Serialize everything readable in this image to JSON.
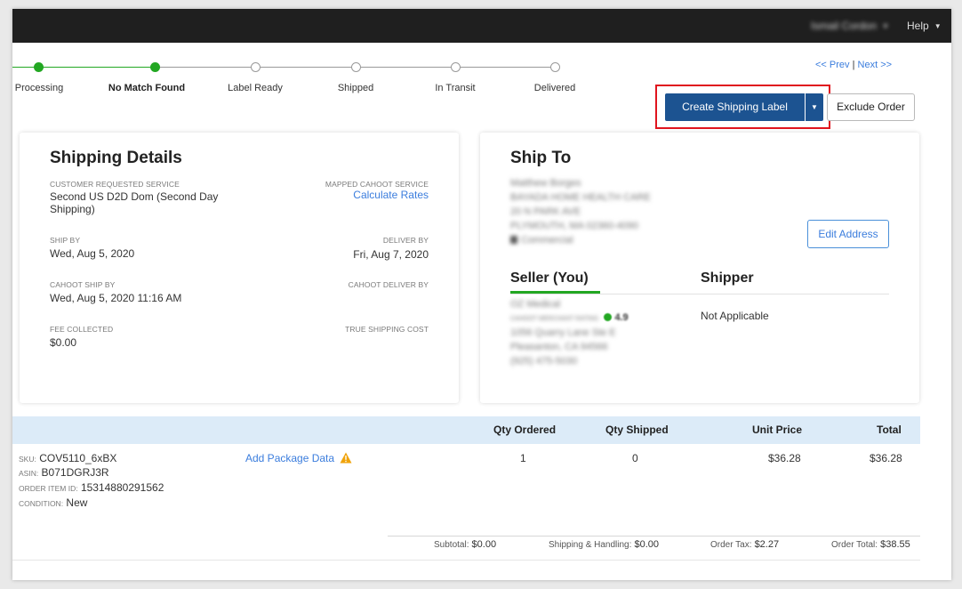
{
  "topbar": {
    "user_menu": "Ismail Cordon",
    "help": "Help",
    "caret": "▼"
  },
  "progress": {
    "steps": [
      {
        "label": "Processing",
        "status": "done"
      },
      {
        "label": "No Match Found",
        "status": "current"
      },
      {
        "label": "Label Ready",
        "status": "pending"
      },
      {
        "label": "Shipped",
        "status": "pending"
      },
      {
        "label": "In Transit",
        "status": "pending"
      },
      {
        "label": "Delivered",
        "status": "pending"
      }
    ],
    "done_color": "#22a722"
  },
  "pager": {
    "prev": "<< Prev",
    "separator": "|",
    "next": "Next >>"
  },
  "actions": {
    "create_label": "Create Shipping Label",
    "exclude_order": "Exclude Order",
    "primary_color": "#1c5391",
    "highlight_color": "#e0141e"
  },
  "shipping_details": {
    "title": "Shipping Details",
    "customer_service_label": "CUSTOMER REQUESTED SERVICE",
    "customer_service_line1": "Second US D2D Dom (Second Day",
    "customer_service_line2": "Shipping)",
    "mapped_label": "MAPPED CAHOOT SERVICE",
    "calculate_rates": "Calculate Rates",
    "ship_by_label": "SHIP BY",
    "ship_by": "Wed, Aug 5, 2020",
    "deliver_by_label": "DELIVER BY",
    "deliver_by": "Fri, Aug 7, 2020",
    "cahoot_ship_by_label": "CAHOOT SHIP BY",
    "cahoot_ship_by": "Wed, Aug 5, 2020 11:16 AM",
    "cahoot_deliver_by_label": "CAHOOT DELIVER BY",
    "fee_label": "FEE COLLECTED",
    "fee": "$0.00",
    "true_cost_label": "TRUE SHIPPING COST"
  },
  "ship_to": {
    "title": "Ship To",
    "name": "Matthew Borges",
    "company": "BAYADA HOME HEALTH CARE",
    "street": "20 N PARK AVE",
    "city": "PLYMOUTH, MA 02360-4090",
    "type": "Commercial",
    "edit_address": "Edit Address"
  },
  "seller": {
    "title": "Seller (You)",
    "name": "OZ Medical",
    "rating_label": "CAHOOT MERCHANT RATING",
    "rating": "4.9",
    "street": "1056 Quarry Lane Ste E",
    "city": "Pleasanton, CA 94566",
    "phone": "(925) 475-5030"
  },
  "shipper": {
    "title": "Shipper",
    "value": "Not Applicable"
  },
  "items": {
    "headers": {
      "qty_ordered": "Qty Ordered",
      "qty_shipped": "Qty Shipped",
      "unit_price": "Unit Price",
      "total": "Total"
    },
    "row": {
      "sku_label": "SKU:",
      "sku": "COV5110_6xBX",
      "asin_label": "ASIN:",
      "asin": "B071DGRJ3R",
      "order_item_label": "ORDER ITEM ID:",
      "order_item_id": "15314880291562",
      "condition_label": "CONDITION:",
      "condition": "New",
      "add_package_data": "Add Package Data",
      "qty_ordered": "1",
      "qty_shipped": "0",
      "unit_price": "$36.28",
      "total": "$36.28"
    },
    "header_bg": "#dcebf8"
  },
  "totals": {
    "subtotal_label": "Subtotal:",
    "subtotal": "$0.00",
    "shipping_label": "Shipping & Handling:",
    "shipping": "$0.00",
    "tax_label": "Order Tax:",
    "tax": "$2.27",
    "order_total_label": "Order Total:",
    "order_total": "$38.55"
  }
}
